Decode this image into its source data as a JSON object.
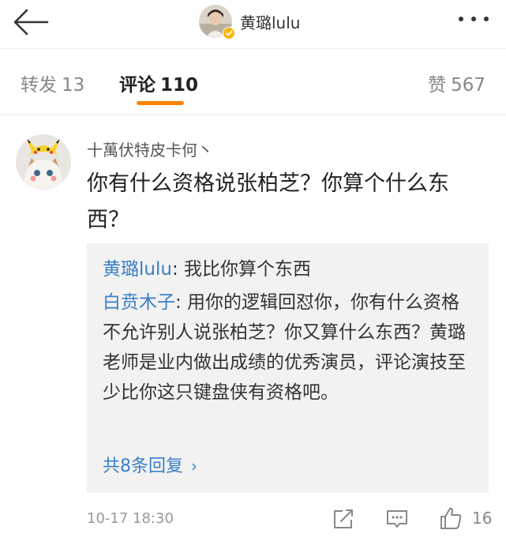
{
  "header": {
    "title": "黄璐lulu",
    "back_icon": "arrow-left-icon",
    "more_icon": "more-dots-icon",
    "verified_color": "#f7b500"
  },
  "tabs": {
    "repost_label": "转发",
    "repost_count": "13",
    "comment_label": "评论",
    "comment_count": "110",
    "like_label": "赞",
    "like_count": "567",
    "accent_color": "#ff8200"
  },
  "comment": {
    "author": "十萬伏特皮卡何丶",
    "text": "你有什么资格说张柏芝？你算个什么东西？",
    "replies": [
      {
        "name": "黄璐lulu",
        "text": ": 我比你算个东西"
      },
      {
        "name": "白贲木子",
        "text": ": 用你的逻辑回怼你，你有什么资格不允许别人说张柏芝？你又算什么东西？黄璐老师是业内做出成绩的优秀演员，评论演技至少比你这只键盘侠有资格吧。"
      }
    ],
    "more_replies": "共8条回复",
    "timestamp": "10-17 18:30",
    "like_count": "16",
    "link_color": "#3b7fc4"
  }
}
